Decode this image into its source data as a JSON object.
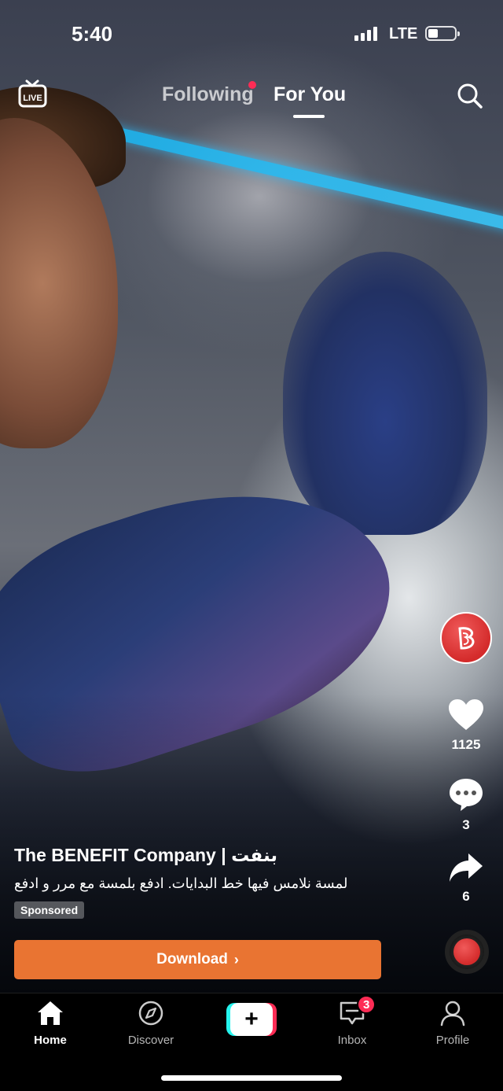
{
  "status_bar": {
    "time": "5:40",
    "network": "LTE"
  },
  "top_nav": {
    "live_label": "LIVE",
    "tabs": [
      {
        "label": "Following",
        "active": false,
        "has_dot": true
      },
      {
        "label": "For You",
        "active": true
      }
    ]
  },
  "video": {
    "author": "The BENEFIT Company | بنفت",
    "description": "لمسة نلامس فيها خط البدايات. ادفع بلمسة مع مرر و ادفع",
    "sponsored_label": "Sponsored",
    "cta_label": "Download",
    "cta_color": "#e97432"
  },
  "actions": {
    "likes": "1125",
    "comments": "3",
    "shares": "6"
  },
  "bottom_nav": {
    "home": "Home",
    "discover": "Discover",
    "inbox": "Inbox",
    "inbox_badge": "3",
    "profile": "Profile"
  },
  "colors": {
    "accent_red": "#fe2c55",
    "accent_cyan": "#25f4ee",
    "brand_red": "#d42b2b"
  }
}
